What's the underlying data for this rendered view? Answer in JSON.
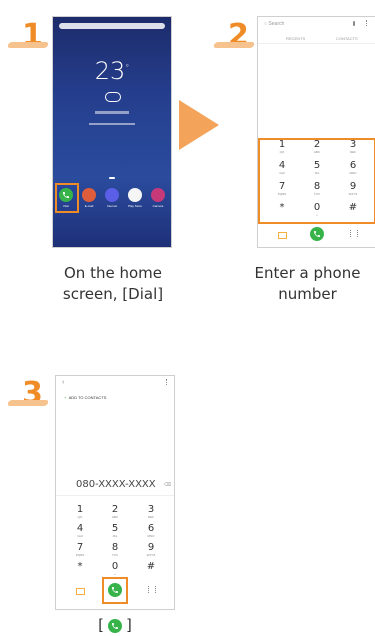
{
  "steps": [
    {
      "number": "1",
      "caption_line1": "On the home",
      "caption_line2": "screen, [Dial]"
    },
    {
      "number": "2",
      "caption_line1": "Enter a phone",
      "caption_line2": "number"
    },
    {
      "number": "3",
      "caption_prefix": "[",
      "caption_suffix": "]"
    }
  ],
  "home": {
    "clock": "23",
    "dock": [
      "Dial",
      "E-mail",
      "Internet",
      "Play Store",
      "Camera"
    ]
  },
  "dialer": {
    "search": "Search",
    "tabs": [
      "RECENTS",
      "CONTACTS"
    ],
    "add_contacts": "ADD TO CONTACTS",
    "number": "080-XXXX-XXXX",
    "keys": [
      {
        "d": "1",
        "l": "QO"
      },
      {
        "d": "2",
        "l": "ABC"
      },
      {
        "d": "3",
        "l": "DEF"
      },
      {
        "d": "4",
        "l": "GHI"
      },
      {
        "d": "5",
        "l": "JKL"
      },
      {
        "d": "6",
        "l": "MNO"
      },
      {
        "d": "7",
        "l": "PQRS"
      },
      {
        "d": "8",
        "l": "TUV"
      },
      {
        "d": "9",
        "l": "WXYZ"
      },
      {
        "d": "*",
        "l": ""
      },
      {
        "d": "0",
        "l": "+"
      },
      {
        "d": "#",
        "l": ""
      }
    ]
  },
  "colors": {
    "accent": "#f08c28",
    "call_green": "#37b34a",
    "home_bg": "#24408f"
  },
  "icons": [
    "arrow-right-icon",
    "phone-icon",
    "mic-icon",
    "more-icon",
    "message-icon",
    "voicemail-icon",
    "back-icon",
    "plus-icon"
  ]
}
